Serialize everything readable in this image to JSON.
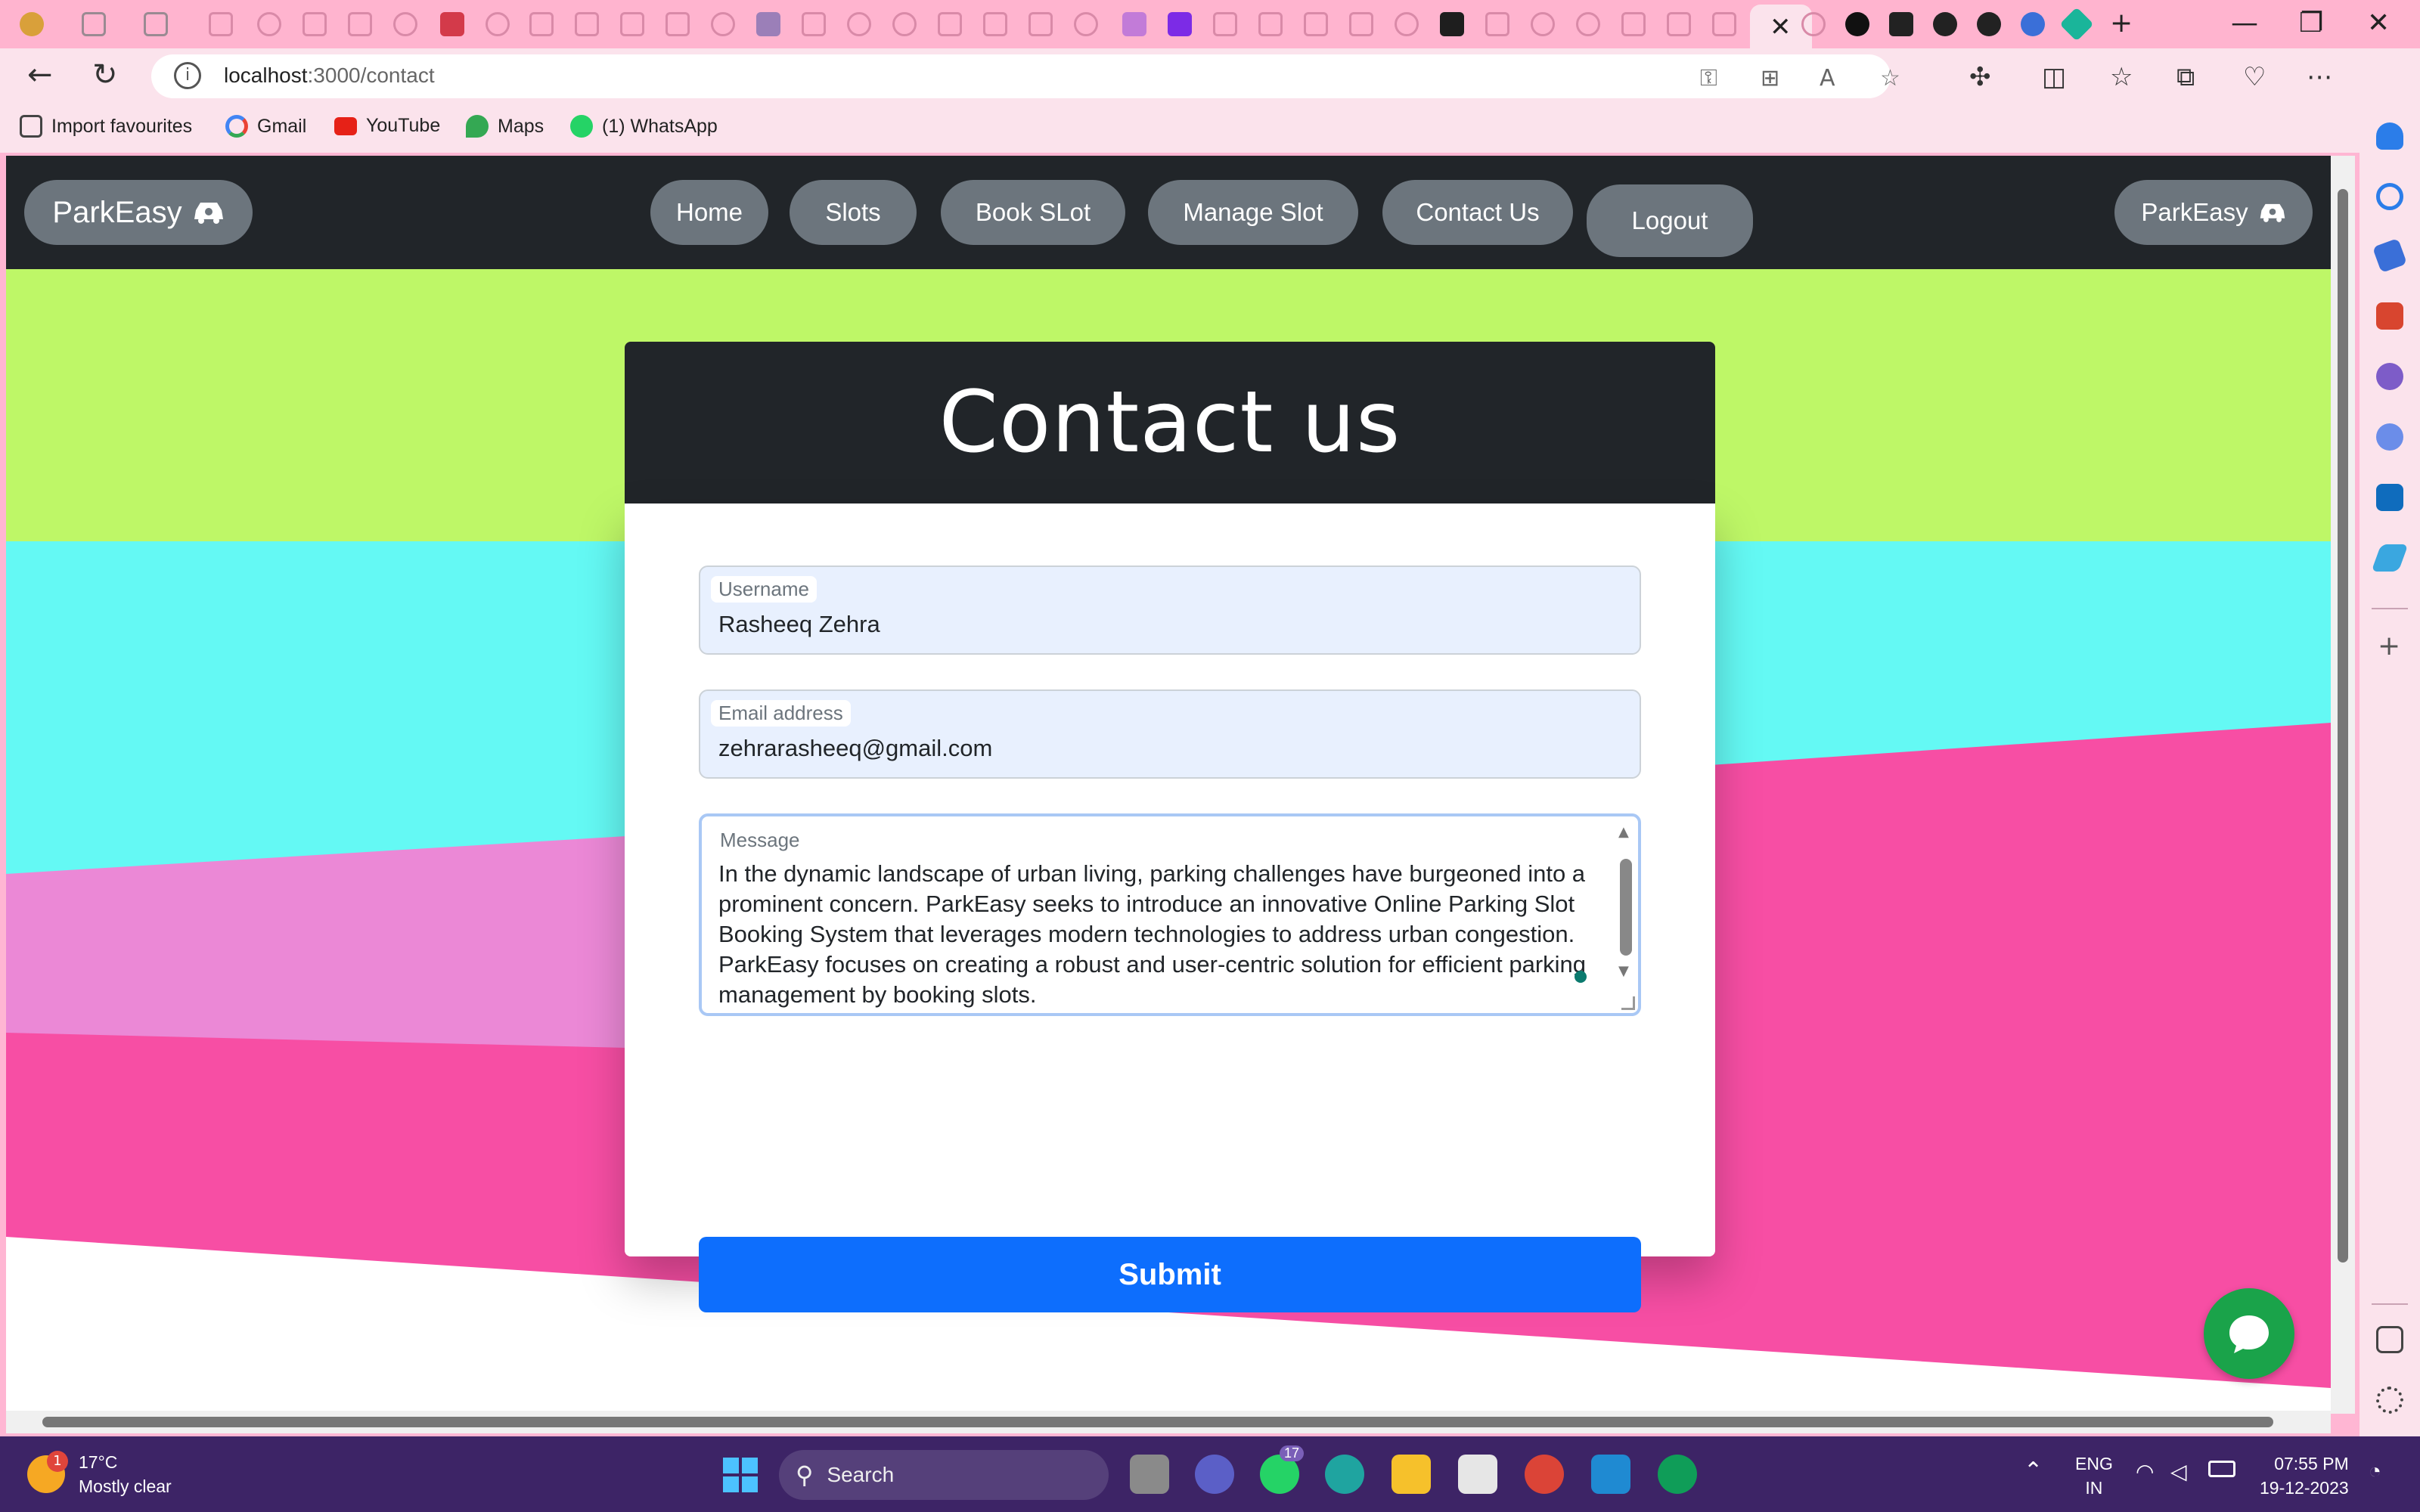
{
  "browser": {
    "url_host": "localhost",
    "url_path": ":3000/contact",
    "bookmarks": [
      {
        "label": "Import favourites"
      },
      {
        "label": "Gmail"
      },
      {
        "label": "YouTube"
      },
      {
        "label": "Maps"
      },
      {
        "label": "(1) WhatsApp"
      }
    ],
    "tab_close": "✕",
    "minimize": "—",
    "restore": "❐",
    "close": "✕",
    "new_tab": "+"
  },
  "navbar": {
    "brand_left": "ParkEasy",
    "items": [
      "Home",
      "Slots",
      "Book SLot",
      "Manage Slot",
      "Contact Us",
      "Logout"
    ],
    "brand_right": "ParkEasy"
  },
  "contact": {
    "title": "Contact us",
    "username_label": "Username",
    "username_value": "Rasheeq Zehra",
    "email_label": "Email address",
    "email_value": "zehrarasheeq@gmail.com",
    "message_label": "Message",
    "message_value": "In the dynamic landscape of urban living, parking challenges have burgeoned into a prominent concern. ParkEasy seeks to introduce an innovative Online Parking Slot Booking System that leverages modern technologies to address urban congestion. ParkEasy focuses on creating a robust and user-centric solution for efficient parking management by booking slots.",
    "submit_label": "Submit"
  },
  "taskbar": {
    "weather_temp": "17°C",
    "weather_desc": "Mostly clear",
    "weather_badge": "1",
    "search_label": "Search",
    "whatsapp_badge": "17",
    "lang_top": "ENG",
    "lang_bottom": "IN",
    "time": "07:55 PM",
    "date": "19-12-2023"
  },
  "colors": {
    "navbar_bg": "#212529",
    "pill_bg": "#6c757d",
    "submit_bg": "#0d6efd",
    "bg_lime": "#bef767",
    "bg_cyan": "#64f9f4",
    "bg_pink": "#f74ea4",
    "bg_lilac": "#eb88d6",
    "chat_green": "#1aa34a"
  }
}
